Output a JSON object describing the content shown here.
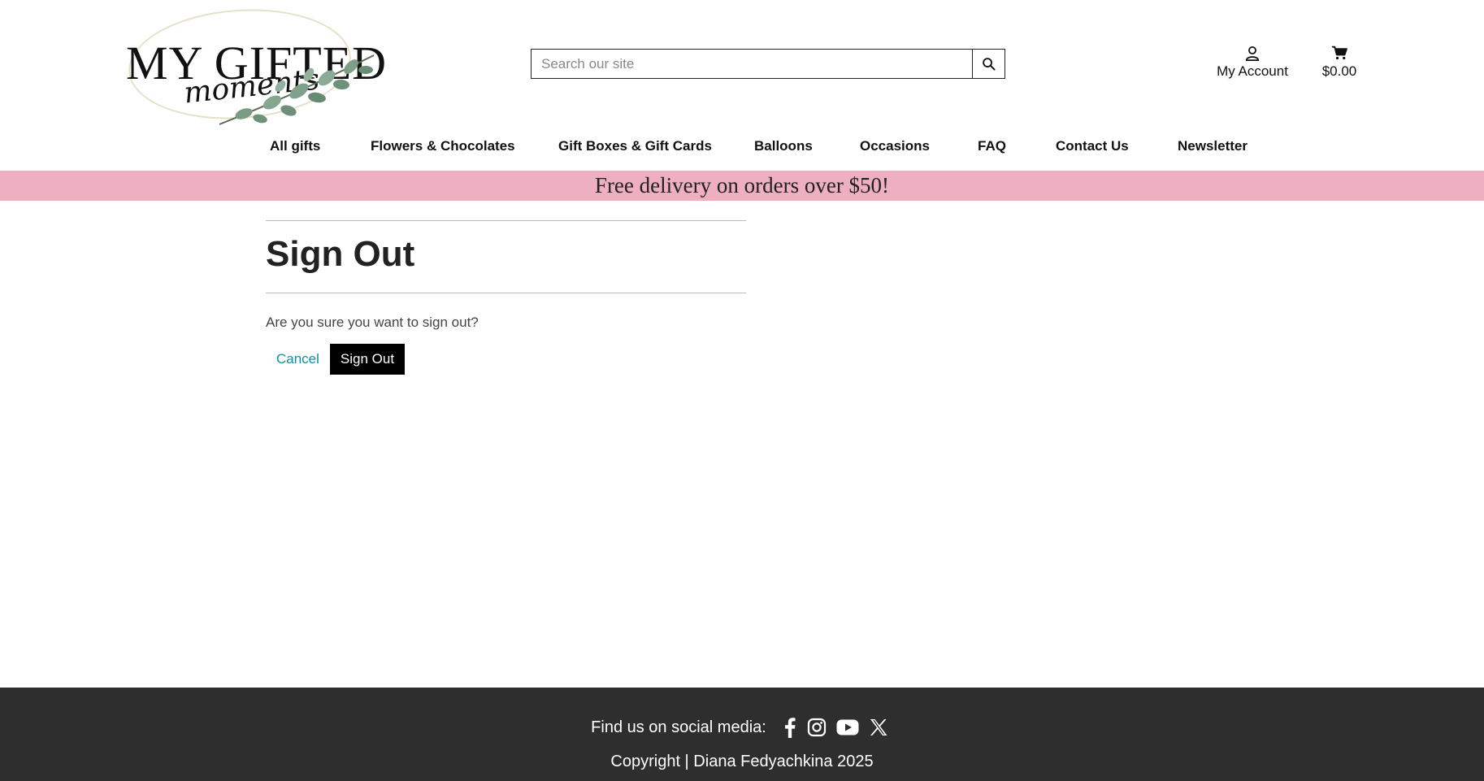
{
  "header": {
    "logo": {
      "main_text": "MY GIFTED",
      "script_text": "moments"
    },
    "search": {
      "placeholder": "Search our site",
      "value": ""
    },
    "account_label": "My Account",
    "cart_total": "$0.00"
  },
  "nav": {
    "items": [
      {
        "label": "All gifts"
      },
      {
        "label": "Flowers & Chocolates"
      },
      {
        "label": "Gift Boxes & Gift Cards"
      },
      {
        "label": "Balloons"
      },
      {
        "label": "Occasions"
      },
      {
        "label": "FAQ"
      },
      {
        "label": "Contact Us"
      },
      {
        "label": "Newsletter"
      }
    ]
  },
  "banner": {
    "text": "Free delivery on orders over $50!",
    "color": "#eeafc0"
  },
  "main": {
    "title": "Sign Out",
    "message": "Are you sure you want to sign out?",
    "cancel_label": "Cancel",
    "signout_label": "Sign Out"
  },
  "footer": {
    "social_label": "Find us on social media:",
    "social_icons": [
      "facebook-icon",
      "instagram-icon",
      "youtube-icon",
      "x-icon"
    ],
    "copyright": "Copyright | Diana Fedyachkina 2025",
    "background": "#2e2e2e"
  },
  "colors": {
    "accent_link": "#0f8fa4",
    "primary_button": "#000000"
  }
}
